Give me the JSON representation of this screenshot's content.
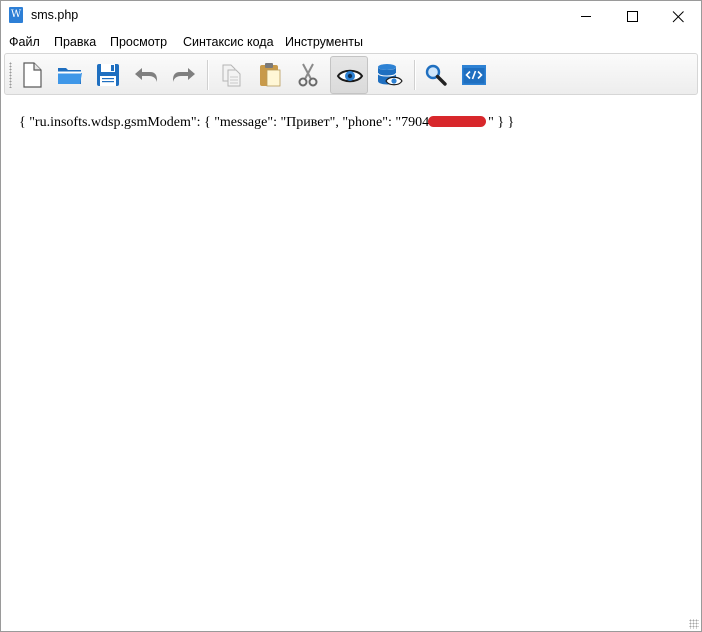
{
  "window": {
    "title": "sms.php",
    "app_icon_letter": "W",
    "controls": [
      "minimize-icon",
      "maximize-icon",
      "close-icon"
    ]
  },
  "menu": {
    "items": [
      "Файл",
      "Правка",
      "Просмотр",
      "Синтаксис кода",
      "Инструменты"
    ]
  },
  "toolbar": {
    "buttons": [
      {
        "icon": "new-file-icon"
      },
      {
        "icon": "open-folder-icon"
      },
      {
        "icon": "save-icon"
      },
      {
        "icon": "undo-icon"
      },
      {
        "icon": "redo-icon"
      },
      {
        "icon": "copy-icon"
      },
      {
        "icon": "paste-icon"
      },
      {
        "icon": "cut-icon"
      },
      {
        "icon": "view-icon",
        "active": true
      },
      {
        "icon": "database-view-icon"
      },
      {
        "icon": "search-icon"
      },
      {
        "icon": "code-icon"
      }
    ],
    "accent_color": "#2e82d4"
  },
  "editor": {
    "content_before_redaction": "{ \"ru.insofts.wdsp.gsmModem\": { \"message\": \"Привет\", \"phone\": \"7904",
    "content_after_redaction": "\" } }",
    "redaction_color": "#d8272b"
  }
}
